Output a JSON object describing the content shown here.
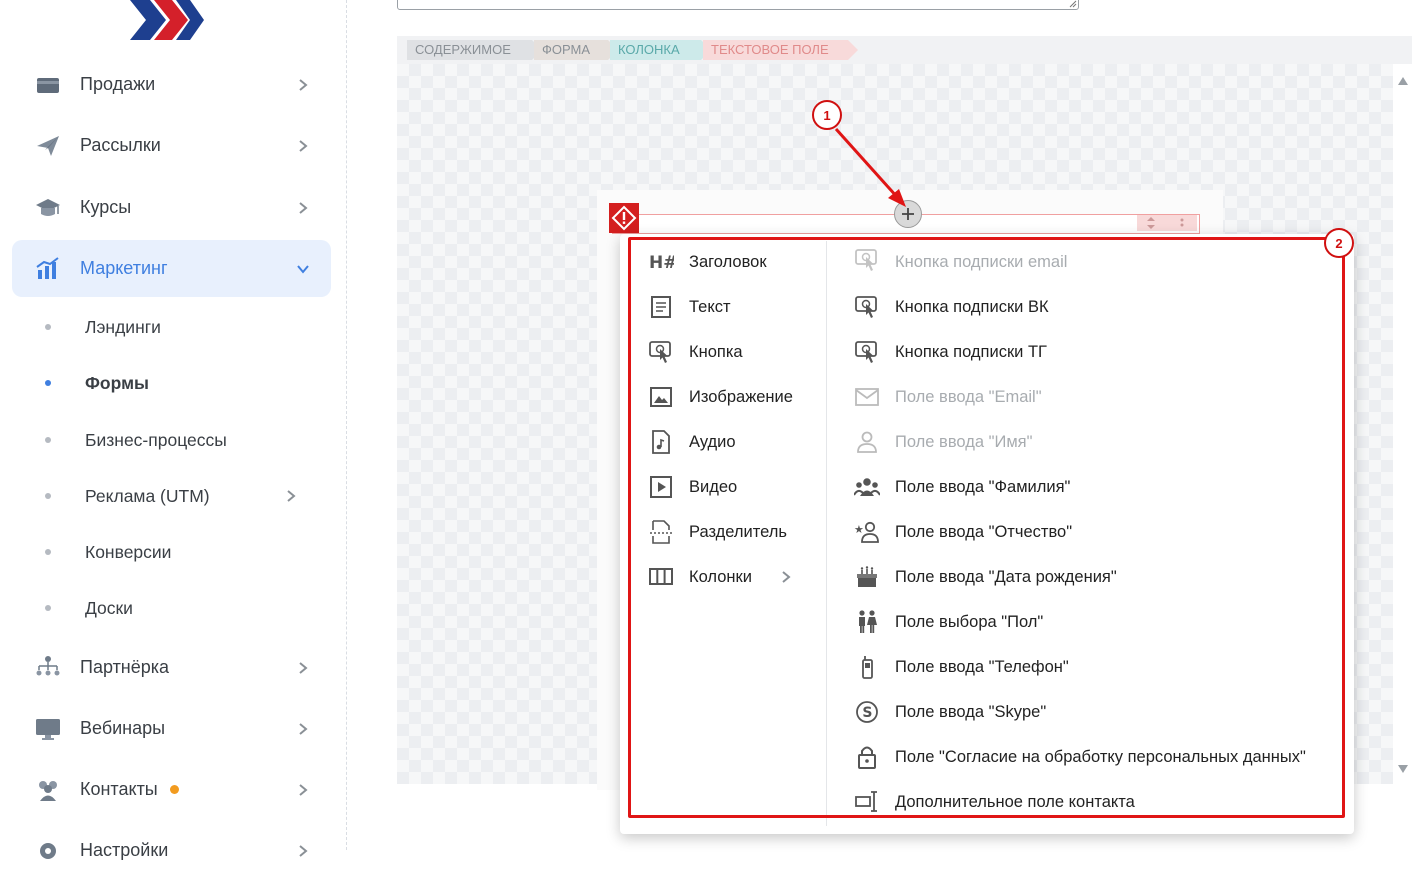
{
  "sidebar": {
    "items": [
      {
        "label": "Продажи",
        "icon": "wallet-icon"
      },
      {
        "label": "Рассылки",
        "icon": "paper-plane-icon"
      },
      {
        "label": "Курсы",
        "icon": "graduation-cap-icon"
      },
      {
        "label": "Маркетинг",
        "icon": "bar-chart-icon",
        "active": true
      },
      {
        "label": "Партнёрка",
        "icon": "org-chart-icon"
      },
      {
        "label": "Вебинары",
        "icon": "monitor-icon"
      },
      {
        "label": "Контакты",
        "icon": "users-icon",
        "badge": true
      },
      {
        "label": "Настройки",
        "icon": "gear-icon"
      }
    ],
    "marketing_sub": [
      {
        "label": "Лэндинги"
      },
      {
        "label": "Формы",
        "active": true
      },
      {
        "label": "Бизнес-процессы"
      },
      {
        "label": "Реклама (UTM)",
        "has_chevron": true
      },
      {
        "label": "Конверсии"
      },
      {
        "label": "Доски"
      }
    ]
  },
  "breadcrumbs": [
    {
      "label": "Содержимое",
      "color": "#dfe1e4"
    },
    {
      "label": "Форма",
      "color": "#e6e0dc"
    },
    {
      "label": "Колонка",
      "color": "#cdeaea"
    },
    {
      "label": "Текстовое поле",
      "color": "#f8dada"
    }
  ],
  "annotations": {
    "callout_1": "1",
    "callout_2": "2"
  },
  "colors": {
    "accent": "#3f7fe0",
    "annotation": "#e01515",
    "badge": "#f29b1f"
  },
  "menu": {
    "left": [
      {
        "label": "Заголовок",
        "icon": "heading-icon"
      },
      {
        "label": "Текст",
        "icon": "text-icon"
      },
      {
        "label": "Кнопка",
        "icon": "button-click-icon"
      },
      {
        "label": "Изображение",
        "icon": "image-icon"
      },
      {
        "label": "Аудио",
        "icon": "audio-file-icon"
      },
      {
        "label": "Видео",
        "icon": "video-icon"
      },
      {
        "label": "Разделитель",
        "icon": "divider-icon"
      },
      {
        "label": "Колонки",
        "icon": "columns-icon",
        "has_chevron": true
      }
    ],
    "right": [
      {
        "label": "Кнопка подписки email",
        "icon": "button-click-icon",
        "disabled": true
      },
      {
        "label": "Кнопка подписки ВК",
        "icon": "button-click-icon"
      },
      {
        "label": "Кнопка подписки ТГ",
        "icon": "button-click-icon"
      },
      {
        "label": "Поле ввода \"Email\"",
        "icon": "envelope-icon",
        "disabled": true
      },
      {
        "label": "Поле ввода \"Имя\"",
        "icon": "person-icon",
        "disabled": true
      },
      {
        "label": "Поле ввода \"Фамилия\"",
        "icon": "group-icon"
      },
      {
        "label": "Поле ввода \"Отчество\"",
        "icon": "star-person-icon"
      },
      {
        "label": "Поле ввода \"Дата рождения\"",
        "icon": "cake-icon"
      },
      {
        "label": "Поле выбора \"Пол\"",
        "icon": "gender-icon"
      },
      {
        "label": "Поле ввода \"Телефон\"",
        "icon": "phone-icon"
      },
      {
        "label": "Поле ввода \"Skype\"",
        "icon": "skype-icon"
      },
      {
        "label": "Поле \"Согласие на обработку персональных данных\"",
        "icon": "lock-icon"
      },
      {
        "label": "Дополнительное поле контакта",
        "icon": "text-cursor-icon"
      }
    ]
  }
}
